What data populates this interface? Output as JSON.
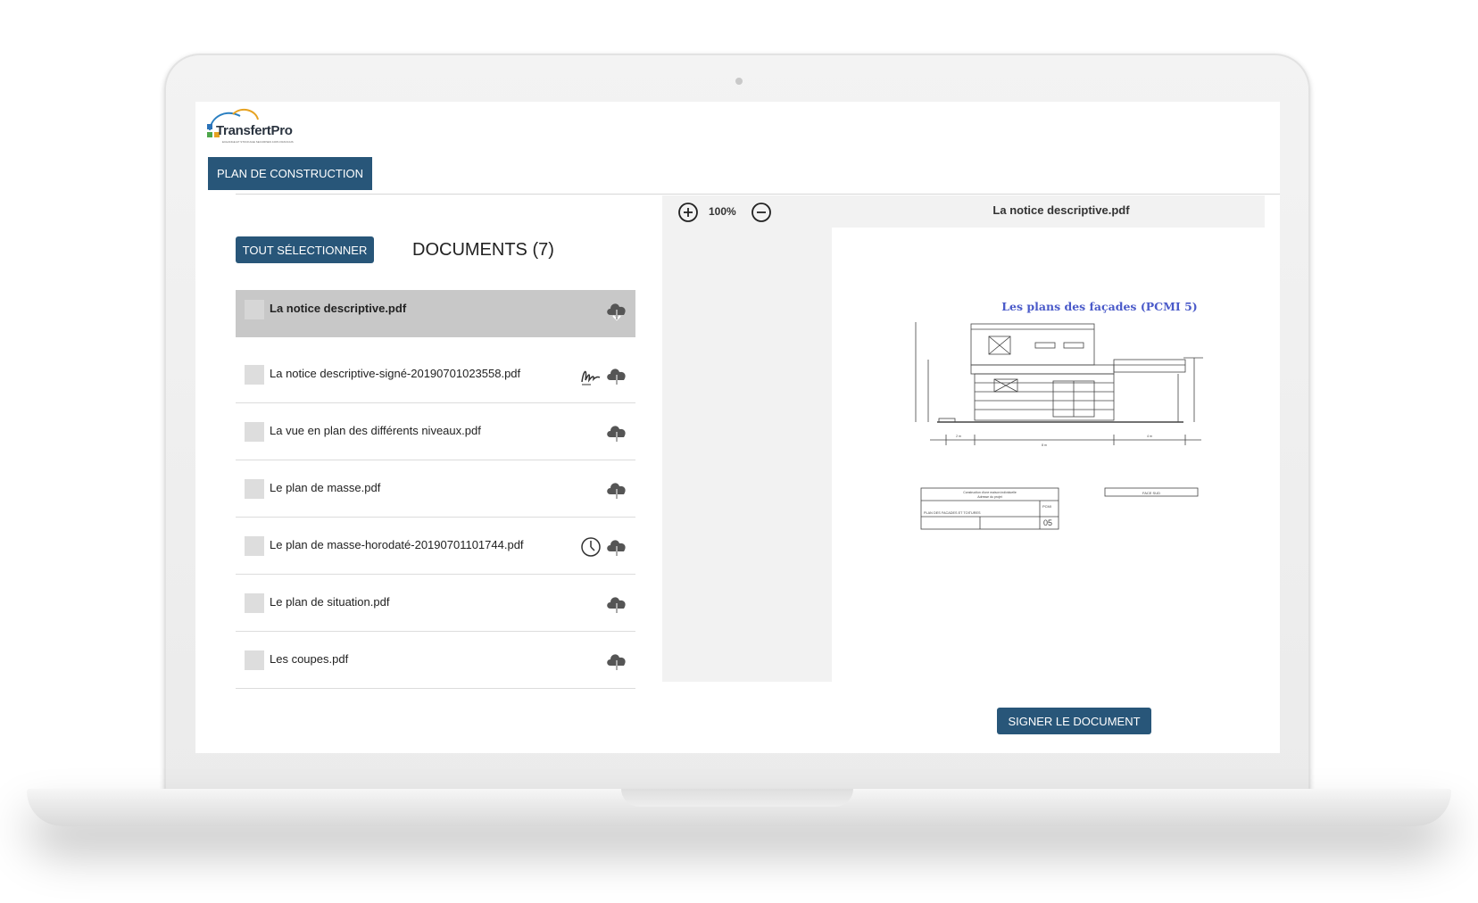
{
  "app": {
    "logo_text": "TransfertPro",
    "logo_tagline": "ECHANGE ET STOCKAGE SECURISES 100% FRANCAIS"
  },
  "folder": {
    "name": "PLAN DE CONSTRUCTION"
  },
  "documents_panel": {
    "select_all_label": "TOUT SÉLECTIONNER",
    "heading": "DOCUMENTS (7)",
    "items": [
      {
        "name": "La notice descriptive.pdf",
        "selected": true,
        "extra_icon": null
      },
      {
        "name": "La notice descriptive-signé-20190701023558.pdf",
        "selected": false,
        "extra_icon": "signature-icon"
      },
      {
        "name": "La vue en plan des différents niveaux.pdf",
        "selected": false,
        "extra_icon": null
      },
      {
        "name": "Le plan de masse.pdf",
        "selected": false,
        "extra_icon": null
      },
      {
        "name": "Le plan de masse-horodaté-20190701101744.pdf",
        "selected": false,
        "extra_icon": "clock-icon"
      },
      {
        "name": "Le plan de situation.pdf",
        "selected": false,
        "extra_icon": null
      },
      {
        "name": "Les coupes.pdf",
        "selected": false,
        "extra_icon": null
      }
    ],
    "row_icon": "cloud-download-icon"
  },
  "viewer": {
    "zoom_level": "100%",
    "zoom_in_icon": "plus-circle-icon",
    "zoom_out_icon": "minus-circle-icon",
    "document_title": "La notice descriptive.pdf",
    "page_heading": "Les plans des façades (PCMI 5)",
    "drawing": {
      "cartouche_title": "Construction d'une maison individuelle",
      "cartouche_subtitle": "Adresse du projet",
      "cartouche_code": "PCMI",
      "cartouche_sheet": "PLAN DES FACADES ET TOITURES",
      "cartouche_number": "05",
      "facade_label": "FACE SUD",
      "dims": [
        "2 m",
        "8 m",
        "4 m"
      ]
    }
  },
  "actions": {
    "sign_label": "SIGNER LE DOCUMENT"
  },
  "colors": {
    "primary": "#285679",
    "selected_row": "#c8c8c8",
    "viewer_bg": "#f2f2f2",
    "heading_blue": "#4a5ac9"
  }
}
